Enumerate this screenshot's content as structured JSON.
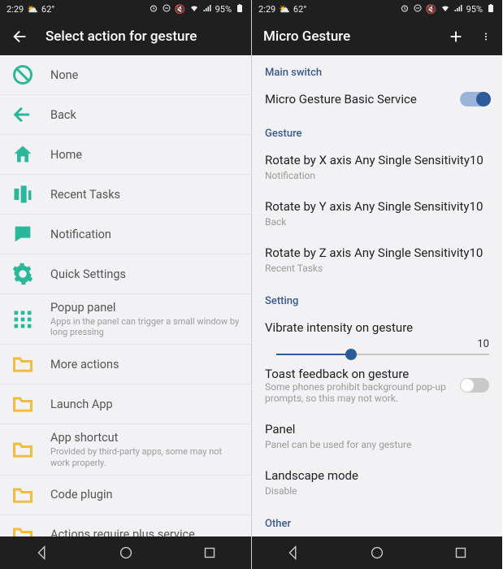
{
  "status": {
    "time": "2:29",
    "temp": "62°",
    "battery": "95%"
  },
  "left": {
    "title": "Select action for gesture",
    "items": [
      {
        "icon": "none",
        "label": "None",
        "sub": ""
      },
      {
        "icon": "back",
        "label": "Back",
        "sub": ""
      },
      {
        "icon": "home",
        "label": "Home",
        "sub": ""
      },
      {
        "icon": "recent",
        "label": "Recent Tasks",
        "sub": ""
      },
      {
        "icon": "notif",
        "label": "Notification",
        "sub": ""
      },
      {
        "icon": "qs",
        "label": "Quick Settings",
        "sub": ""
      },
      {
        "icon": "popup",
        "label": "Popup panel",
        "sub": "Apps in the panel can trigger a small window by long pressing"
      },
      {
        "icon": "folder",
        "label": "More actions",
        "sub": ""
      },
      {
        "icon": "folder",
        "label": "Launch App",
        "sub": ""
      },
      {
        "icon": "folder",
        "label": "App shortcut",
        "sub": "Provided by third-party apps, some may not work properly."
      },
      {
        "icon": "folder",
        "label": "Code plugin",
        "sub": ""
      },
      {
        "icon": "folder",
        "label": "Actions require plus service",
        "sub": ""
      }
    ]
  },
  "right": {
    "title": "Micro Gesture",
    "section_main": "Main switch",
    "basic_service": "Micro Gesture Basic Service",
    "basic_service_on": true,
    "section_gesture": "Gesture",
    "gestures": [
      {
        "title": "Rotate by X axis Any Single Sensitivity10",
        "sub": "Notification"
      },
      {
        "title": "Rotate by Y axis Any Single Sensitivity10",
        "sub": "Back"
      },
      {
        "title": "Rotate by Z axis Any Single Sensitivity10",
        "sub": "Recent Tasks"
      }
    ],
    "section_setting": "Setting",
    "vibrate_label": "Vibrate intensity on gesture",
    "vibrate_value": "10",
    "vibrate_percent": 35,
    "toast_label": "Toast feedback on gesture",
    "toast_sub": "Some phones prohibit background pop-up prompts, so this may not work.",
    "toast_on": false,
    "panel_label": "Panel",
    "panel_sub": "Panel can be used for any gesture",
    "landscape_label": "Landscape mode",
    "landscape_sub": "Disable",
    "section_other": "Other"
  },
  "colors": {
    "teal": "#2bb79a",
    "amber": "#f0bd3b",
    "header": "#3b5a8c",
    "switch": "#2d5a9a"
  }
}
